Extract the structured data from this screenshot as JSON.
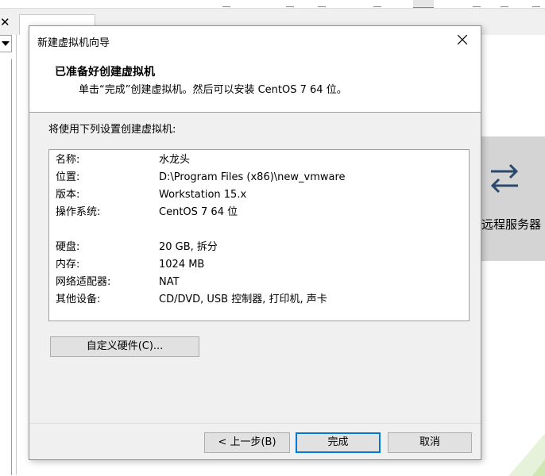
{
  "background": {
    "close_glyph": "✕",
    "remote_card_label": "远程服务器",
    "remote_icon": "swap-arrows-icon"
  },
  "wizard": {
    "title": "新建虚拟机向导",
    "header_title": "已准备好创建虚拟机",
    "header_subtitle": "单击“完成”创建虚拟机。然后可以安装 CentOS 7 64 位。",
    "intro": "将使用下列设置创建虚拟机:",
    "summary": [
      {
        "key": "名称:",
        "value": "水龙头"
      },
      {
        "key": "位置:",
        "value": "D:\\Program Files (x86)\\new_vmware"
      },
      {
        "key": "版本:",
        "value": "Workstation 15.x"
      },
      {
        "key": "操作系统:",
        "value": "CentOS 7 64 位"
      },
      {
        "key": "硬盘:",
        "value": "20 GB, 拆分"
      },
      {
        "key": "内存:",
        "value": "1024 MB"
      },
      {
        "key": "网络适配器:",
        "value": "NAT"
      },
      {
        "key": "其他设备:",
        "value": "CD/DVD, USB 控制器, 打印机, 声卡"
      }
    ],
    "customize_button": "自定义硬件(C)...",
    "back_button": "< 上一步(B)",
    "finish_button": "完成",
    "cancel_button": "取消"
  },
  "colors": {
    "focus_border": "#0078d7",
    "dialog_bg": "#f0f0f0",
    "remote_card_bg": "#d4d4d4"
  }
}
